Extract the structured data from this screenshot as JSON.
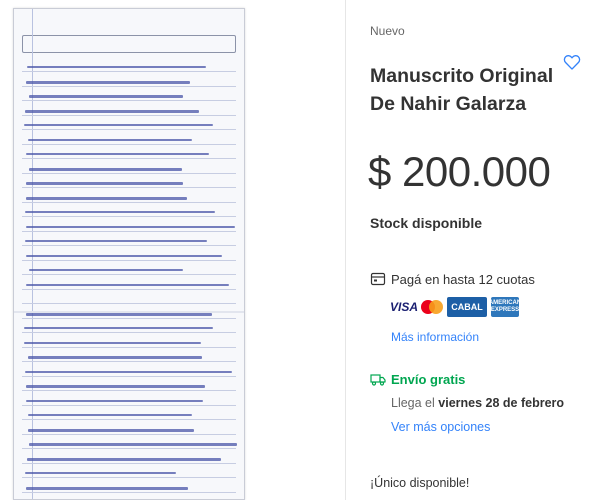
{
  "gallery": {
    "image_alt": "handwritten manuscript page"
  },
  "product": {
    "condition": "Nuevo",
    "title": "Manuscrito Original De Nahir Galarza",
    "price": "$ 200.000",
    "stock": "Stock disponible",
    "favorite_icon": "heart-outline-icon"
  },
  "payment": {
    "icon": "card-icon",
    "installments_text": "Pagá en hasta 12 cuotas",
    "cards": [
      {
        "name": "VISA",
        "icon": "visa-logo"
      },
      {
        "name": "Mastercard",
        "icon": "mastercard-logo"
      },
      {
        "name": "CABAL",
        "icon": "cabal-logo"
      },
      {
        "name": "AMERICAN EXPRESS",
        "icon": "amex-logo"
      }
    ],
    "more_info": "Más información"
  },
  "shipping": {
    "icon": "truck-icon",
    "free_text": "Envío gratis",
    "arrival_prefix": "Llega el",
    "arrival_date": "viernes 28 de febrero",
    "more_options": "Ver más opciones"
  },
  "availability": {
    "text": "¡Único disponible!"
  },
  "colors": {
    "link": "#3483fa",
    "free_shipping": "#00a650",
    "ink": "#4a55a8"
  }
}
